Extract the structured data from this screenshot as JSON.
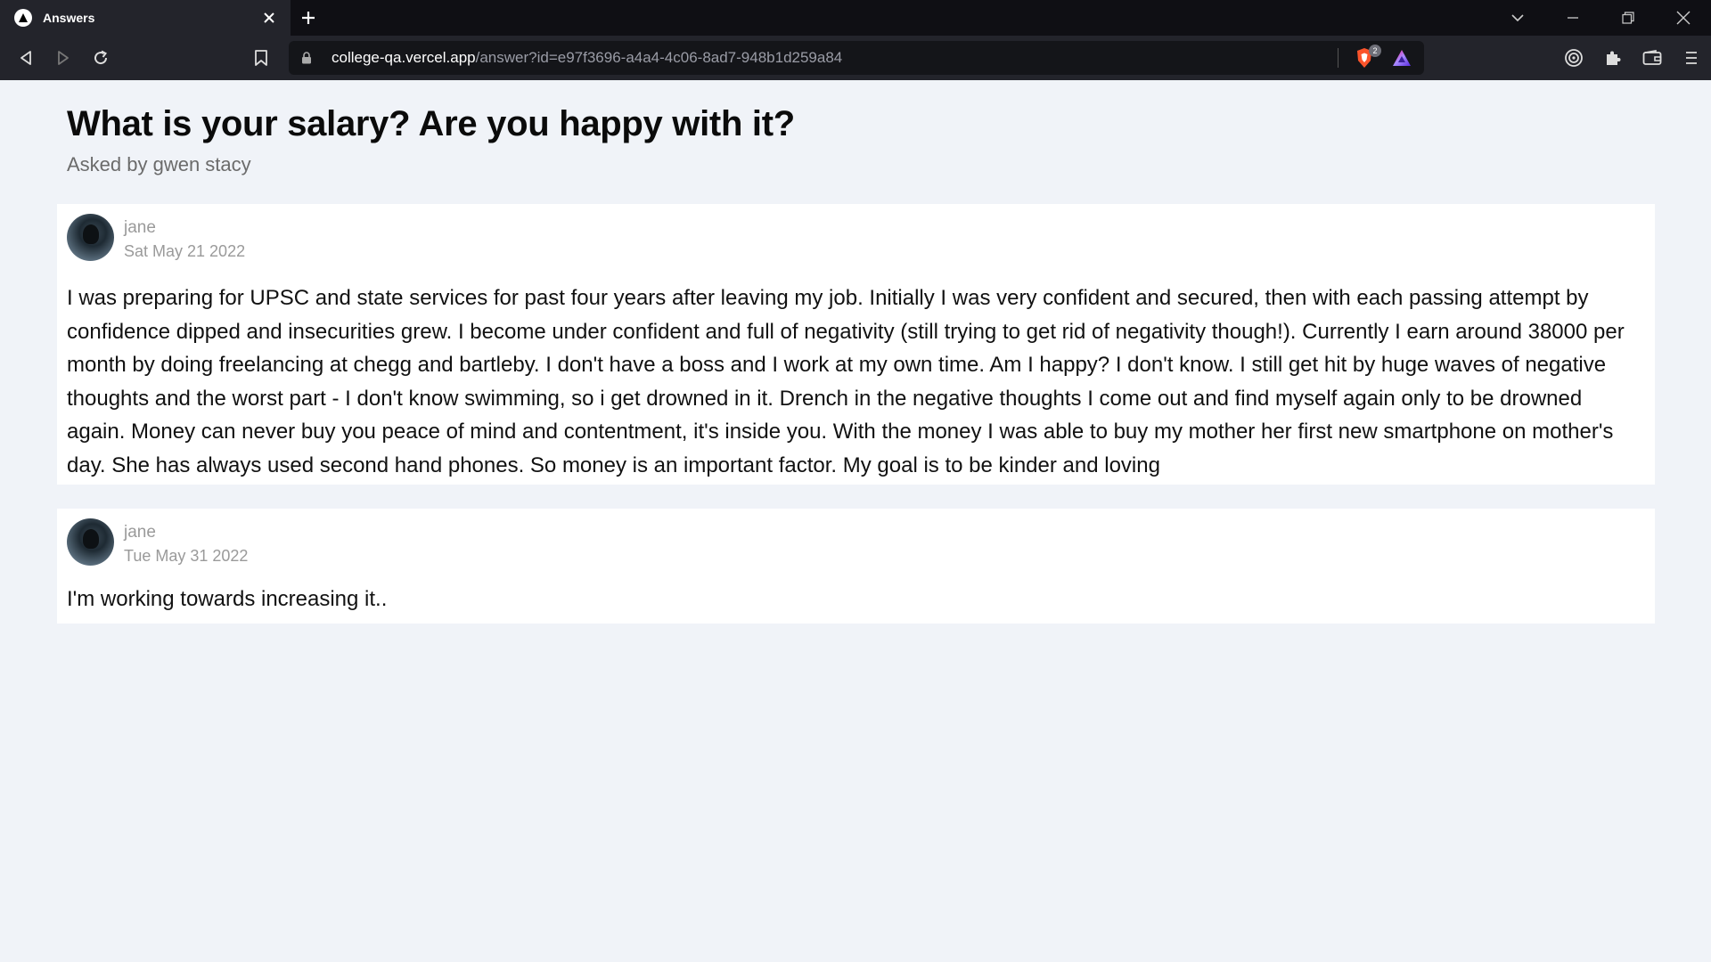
{
  "browser": {
    "tab_title": "Answers",
    "url_host": "college-qa.vercel.app",
    "url_path": "/answer?id=e97f3696-a4a4-4c06-8ad7-948b1d259a84",
    "shield_count": "2"
  },
  "question": {
    "title": "What is your salary? Are you happy with it?",
    "asked_by": "Asked by gwen stacy"
  },
  "answers": [
    {
      "author": "jane",
      "date": "Sat May 21 2022",
      "text": "I was preparing for UPSC and state services for past four years after leaving my job. Initially I was very confident and secured, then with each passing attempt by confidence dipped and insecurities grew. I become under confident and full of negativity (still trying to get rid of negativity though!). Currently I earn around 38000 per month by doing freelancing at chegg and bartleby. I don't have a boss and I work at my own time. Am I happy? I don't know. I still get hit by huge waves of negative thoughts and the worst part - I don't know swimming, so i get drowned in it. Drench in the negative thoughts I come out and find myself again only to be drowned again. Money can never buy you peace of mind and contentment, it's inside you. With the money I was able to buy my mother her first new smartphone on mother's day. She has always used second hand phones. So money is an important factor. My goal is to be kinder and loving"
    },
    {
      "author": "jane",
      "date": "Tue May 31 2022",
      "text": "I'm working towards increasing it.."
    }
  ]
}
